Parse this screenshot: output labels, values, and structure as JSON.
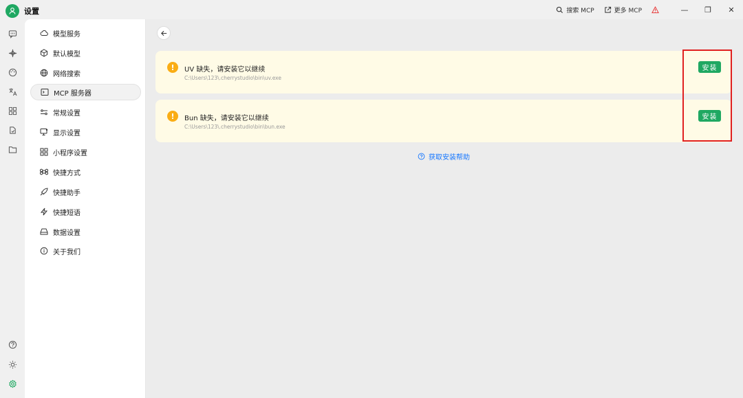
{
  "app": {
    "title": "设置"
  },
  "titlebar": {
    "search_mcp_label": "搜索 MCP",
    "more_mcp_label": "更多 MCP",
    "minimize": "—",
    "maximize": "❐",
    "close": "✕"
  },
  "rail": {
    "icons": [
      "chat-icon",
      "sparkle-icon",
      "palette-icon",
      "translate-icon",
      "apps-icon",
      "knowledge-icon",
      "folder-icon"
    ],
    "bottom_icons": [
      "help-icon",
      "theme-icon",
      "settings-icon"
    ]
  },
  "nav": {
    "items": [
      {
        "label": "模型服务",
        "icon": "cloud-icon"
      },
      {
        "label": "默认模型",
        "icon": "cube-icon"
      },
      {
        "label": "网络搜索",
        "icon": "globe-icon"
      },
      {
        "label": "MCP 服务器",
        "icon": "terminal-icon",
        "active": true
      },
      {
        "label": "常规设置",
        "icon": "sliders-icon"
      },
      {
        "label": "显示设置",
        "icon": "monitor-icon"
      },
      {
        "label": "小程序设置",
        "icon": "grid-icon"
      },
      {
        "label": "快捷方式",
        "icon": "command-icon"
      },
      {
        "label": "快捷助手",
        "icon": "rocket-icon"
      },
      {
        "label": "快捷短语",
        "icon": "zap-icon"
      },
      {
        "label": "数据设置",
        "icon": "drive-icon"
      },
      {
        "label": "关于我们",
        "icon": "info-icon"
      }
    ]
  },
  "main": {
    "alerts": [
      {
        "message": "UV 缺失，请安装它以继续",
        "path": "C:\\Users\\123\\.cherrystudio\\bin\\uv.exe",
        "button": "安装"
      },
      {
        "message": "Bun 缺失，请安装它以继续",
        "path": "C:\\Users\\123\\.cherrystudio\\bin\\bun.exe",
        "button": "安装"
      }
    ],
    "help_link": "获取安装帮助"
  },
  "colors": {
    "accent": "#1fa862",
    "warning": "#faad14",
    "alert_bg": "#fffbe6",
    "link": "#1677ff",
    "highlight": "#e02020"
  }
}
